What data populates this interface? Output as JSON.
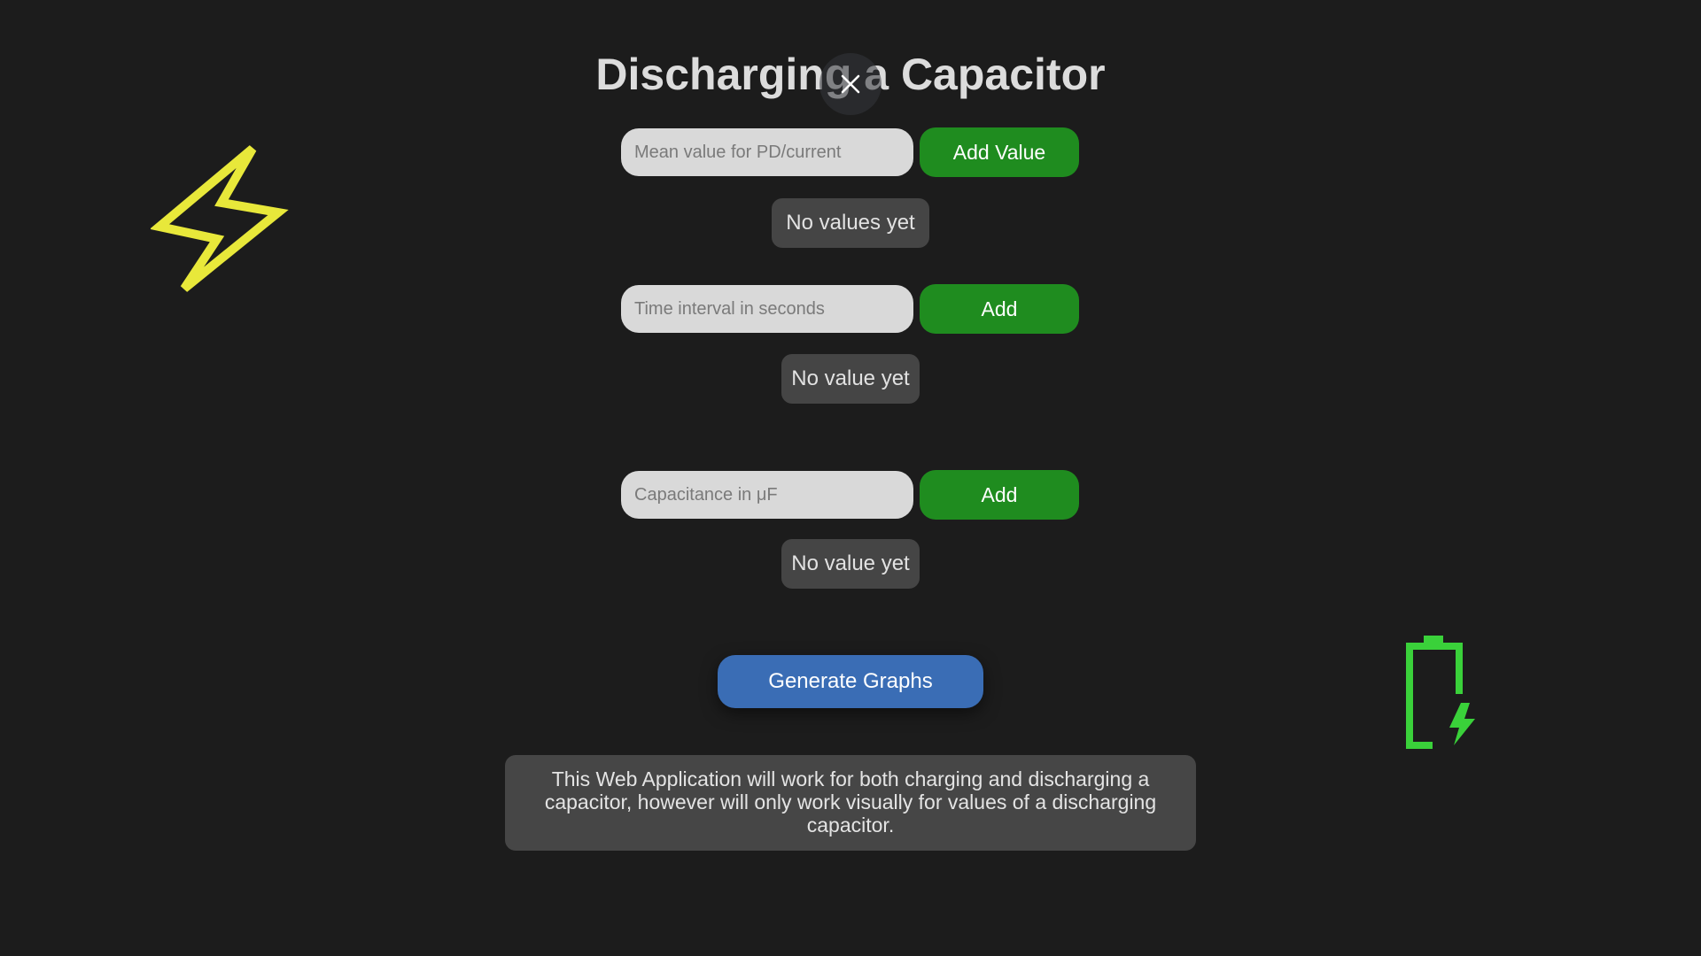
{
  "page": {
    "title": "Discharging a Capacitor"
  },
  "close_button": {
    "icon": "close-icon"
  },
  "pd_current": {
    "placeholder": "Mean value for PD/current",
    "button_label": "Add Value",
    "status": "No values yet"
  },
  "time_interval": {
    "placeholder": "Time interval in seconds",
    "button_label": "Add",
    "status": "No value yet"
  },
  "capacitance": {
    "placeholder": "Capacitance in μF",
    "button_label": "Add",
    "status": "No value yet"
  },
  "generate": {
    "label": "Generate Graphs"
  },
  "info": {
    "text": "This Web Application will work for both charging and discharging a capacitor, however will only work visually for values of a discharging capacitor."
  },
  "decorations": {
    "left_icon": "lightning-bolt-icon",
    "right_icon": "battery-charging-icon",
    "bolt_color": "#e8e83a",
    "battery_color": "#3ad13a"
  },
  "colors": {
    "background": "#1c1c1c",
    "add_button": "#1f8c1f",
    "generate_button": "#3a6db5",
    "panel": "#454545"
  }
}
